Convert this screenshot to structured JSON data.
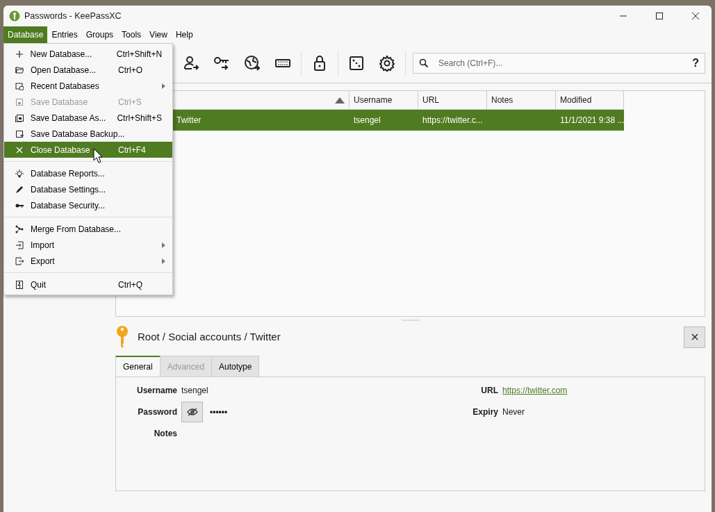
{
  "window": {
    "title": "Passwords - KeePassXC"
  },
  "menubar": [
    {
      "label": "Database",
      "selected": true
    },
    {
      "label": "Entries",
      "selected": false
    },
    {
      "label": "Groups",
      "selected": false
    },
    {
      "label": "Tools",
      "selected": false
    },
    {
      "label": "View",
      "selected": false
    },
    {
      "label": "Help",
      "selected": false
    }
  ],
  "menu": {
    "items": [
      {
        "kind": "item",
        "label": "New Database...",
        "shortcut": "Ctrl+Shift+N",
        "disabled": false,
        "highlighted": false,
        "submenu": false
      },
      {
        "kind": "item",
        "label": "Open Database...",
        "shortcut": "Ctrl+O",
        "disabled": false,
        "highlighted": false,
        "submenu": false
      },
      {
        "kind": "item",
        "label": "Recent Databases",
        "disabled": false,
        "highlighted": false,
        "submenu": true
      },
      {
        "kind": "item",
        "label": "Save Database",
        "shortcut": "Ctrl+S",
        "disabled": true,
        "highlighted": false,
        "submenu": false
      },
      {
        "kind": "item",
        "label": "Save Database As...",
        "shortcut": "Ctrl+Shift+S",
        "disabled": false,
        "highlighted": false,
        "submenu": false
      },
      {
        "kind": "item",
        "label": "Save Database Backup...",
        "disabled": false,
        "highlighted": false,
        "submenu": false
      },
      {
        "kind": "item",
        "label": "Close Database",
        "shortcut": "Ctrl+F4",
        "disabled": false,
        "highlighted": true,
        "submenu": false
      },
      {
        "kind": "separator"
      },
      {
        "kind": "item",
        "label": "Database Reports...",
        "disabled": false,
        "highlighted": false,
        "submenu": false
      },
      {
        "kind": "item",
        "label": "Database Settings...",
        "disabled": false,
        "highlighted": false,
        "submenu": false
      },
      {
        "kind": "item",
        "label": "Database Security...",
        "disabled": false,
        "highlighted": false,
        "submenu": false
      },
      {
        "kind": "separator"
      },
      {
        "kind": "item",
        "label": "Merge From Database...",
        "disabled": false,
        "highlighted": false,
        "submenu": false
      },
      {
        "kind": "item",
        "label": "Import",
        "disabled": false,
        "highlighted": false,
        "submenu": true
      },
      {
        "kind": "item",
        "label": "Export",
        "disabled": false,
        "highlighted": false,
        "submenu": true
      },
      {
        "kind": "separator"
      },
      {
        "kind": "item",
        "label": "Quit",
        "shortcut": "Ctrl+Q",
        "disabled": false,
        "highlighted": false,
        "submenu": false
      }
    ]
  },
  "search": {
    "placeholder": "Search (Ctrl+F)...",
    "help": "?"
  },
  "table": {
    "columns": [
      {
        "sorted": true
      },
      {
        "label": "Username",
        "sorted": false
      },
      {
        "label": "URL",
        "sorted": false
      },
      {
        "label": "Notes",
        "sorted": false
      },
      {
        "label": "Modified",
        "sorted": false
      }
    ],
    "rows": [
      {
        "selected": true,
        "title": "Twitter",
        "username": "tsengel",
        "url": "https://twitter.c...",
        "modified": "11/1/2021 9:38 ..."
      }
    ]
  },
  "detail": {
    "path": "Root / Social accounts / Twitter",
    "tabs": [
      {
        "label": "General",
        "selected": true,
        "disabled": false
      },
      {
        "label": "Advanced",
        "selected": false,
        "disabled": true
      },
      {
        "label": "Autotype",
        "selected": false,
        "disabled": false
      }
    ],
    "fields": {
      "username_label": "Username",
      "username": "tsengel",
      "password_label": "Password",
      "password": "••••••",
      "notes_label": "Notes",
      "url_label": "URL",
      "url": "https://twitter.com",
      "expiry_label": "Expiry",
      "expiry": "Never"
    }
  }
}
